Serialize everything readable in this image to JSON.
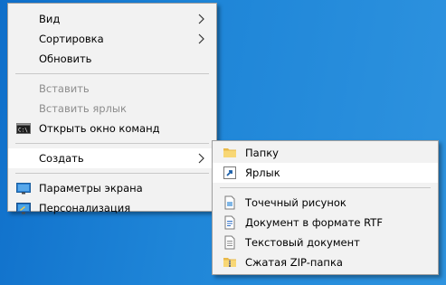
{
  "context_menu": {
    "items": [
      {
        "label": "Вид"
      },
      {
        "label": "Сортировка"
      },
      {
        "label": "Обновить"
      },
      {
        "label": "Вставить"
      },
      {
        "label": "Вставить ярлык"
      },
      {
        "label": "Открыть окно команд",
        "icon": "command-prompt-icon"
      },
      {
        "label": "Создать"
      },
      {
        "label": "Параметры экрана",
        "icon": "display-settings-icon"
      },
      {
        "label": "Персонализация",
        "icon": "personalization-icon"
      }
    ]
  },
  "submenu_create": {
    "items": [
      {
        "label": "Папку",
        "icon": "folder-icon"
      },
      {
        "label": "Ярлык",
        "icon": "shortcut-icon"
      },
      {
        "label": "Точечный рисунок",
        "icon": "bitmap-image-icon"
      },
      {
        "label": "Документ в формате RTF",
        "icon": "rtf-document-icon"
      },
      {
        "label": "Текстовый документ",
        "icon": "text-document-icon"
      },
      {
        "label": "Сжатая ZIP-папка",
        "icon": "zip-folder-icon"
      }
    ]
  },
  "colors": {
    "desktop": "#1f86d8",
    "menu_bg": "#f2f2f2",
    "disabled_text": "#8d8d8d",
    "highlight": "#ffffff"
  }
}
